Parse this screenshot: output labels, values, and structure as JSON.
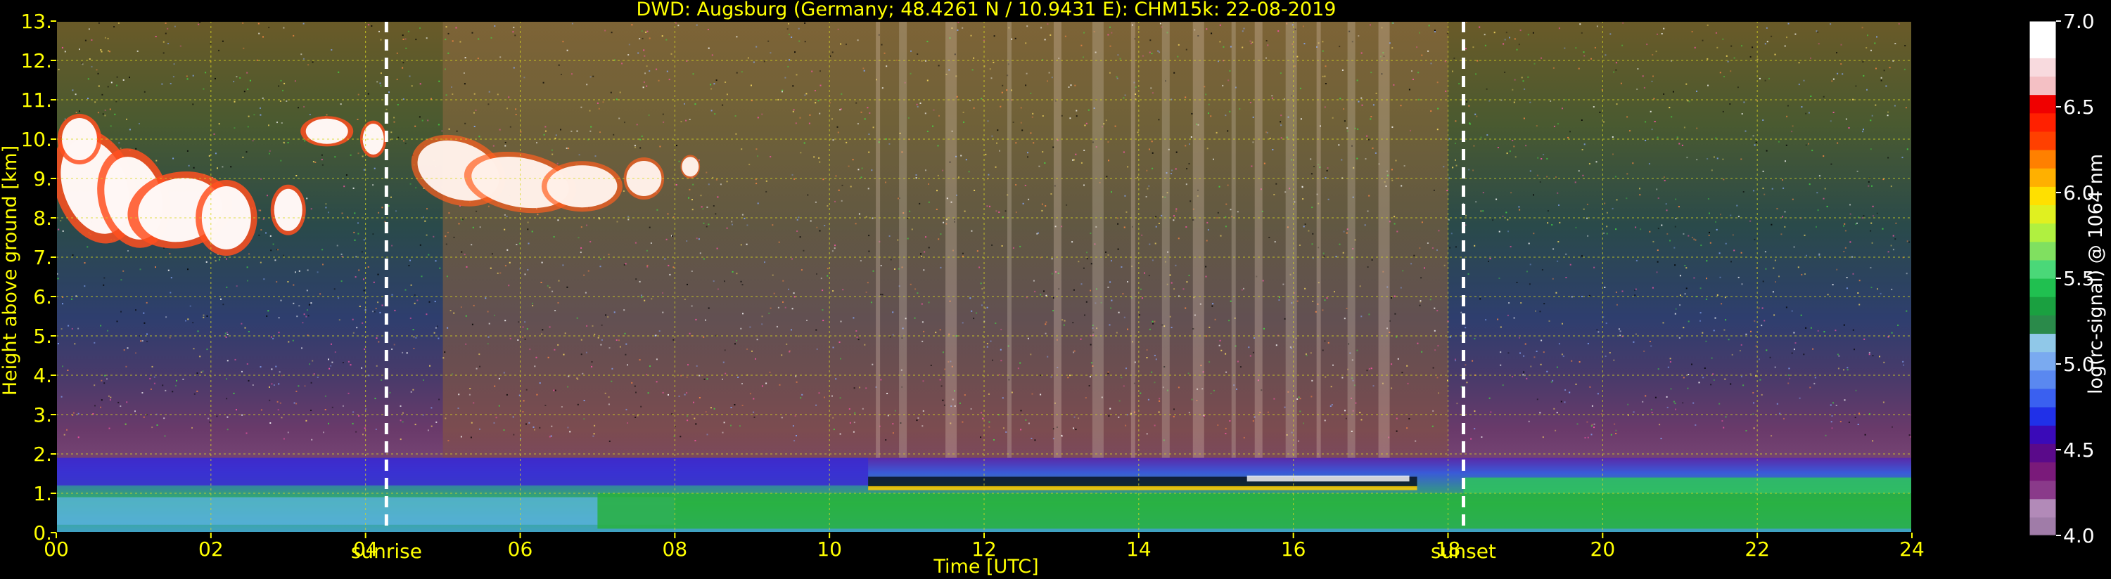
{
  "chart_data": {
    "type": "heatmap",
    "title": "DWD: Augsburg (Germany; 48.4261 N / 10.9431 E):    CHM15k: 22-08-2019",
    "xlabel": "Time [UTC]",
    "ylabel": "Height above ground [km]",
    "xlim": [
      0,
      24
    ],
    "ylim": [
      0,
      13
    ],
    "x_ticks": [
      "00",
      "02",
      "04",
      "06",
      "08",
      "10",
      "12",
      "14",
      "16",
      "18",
      "20",
      "22",
      "24"
    ],
    "y_ticks": [
      "0.",
      "1.",
      "2.",
      "3.",
      "4.",
      "5.",
      "6.",
      "7.",
      "8.",
      "9.",
      "10.",
      "11.",
      "12.",
      "13."
    ],
    "grid": true,
    "annotations": [
      {
        "label": "sunrise",
        "x": 4.27
      },
      {
        "label": "sunset",
        "x": 18.2
      }
    ],
    "colorbar": {
      "label": "log(rc-signal) @ 1064 nm",
      "range": [
        4.0,
        7.0
      ],
      "ticks": [
        "4.0",
        "4.5",
        "5.0",
        "5.5",
        "6.0",
        "6.5",
        "7.0"
      ],
      "colors": [
        "#a07ca8",
        "#b28ab8",
        "#8a3a8a",
        "#7a1a7a",
        "#5a0a8a",
        "#3a0ab8",
        "#2030e8",
        "#3a60f0",
        "#5a88f0",
        "#7aaaf0",
        "#90c8e8",
        "#2a8a4a",
        "#1aa040",
        "#20c050",
        "#4ad878",
        "#80e060",
        "#b0f040",
        "#e0f020",
        "#ffe000",
        "#ffb000",
        "#ff8000",
        "#ff4000",
        "#ff2000",
        "#f00000",
        "#f4c0c4",
        "#f8dade",
        "#ffffff",
        "#ffffff"
      ]
    },
    "features": [
      {
        "name": "cirrus cloud",
        "x_range": [
          0,
          3.2
        ],
        "y_range": [
          6.5,
          10.8
        ],
        "level": 6.6
      },
      {
        "name": "cirrus cloud",
        "x_range": [
          4.6,
          8.3
        ],
        "y_range": [
          8.2,
          10.0
        ],
        "level": 6.8
      },
      {
        "name": "boundary layer top",
        "x_range": [
          10.5,
          17.5
        ],
        "y_range": [
          1.1,
          1.4
        ],
        "level": 6.5
      }
    ]
  }
}
